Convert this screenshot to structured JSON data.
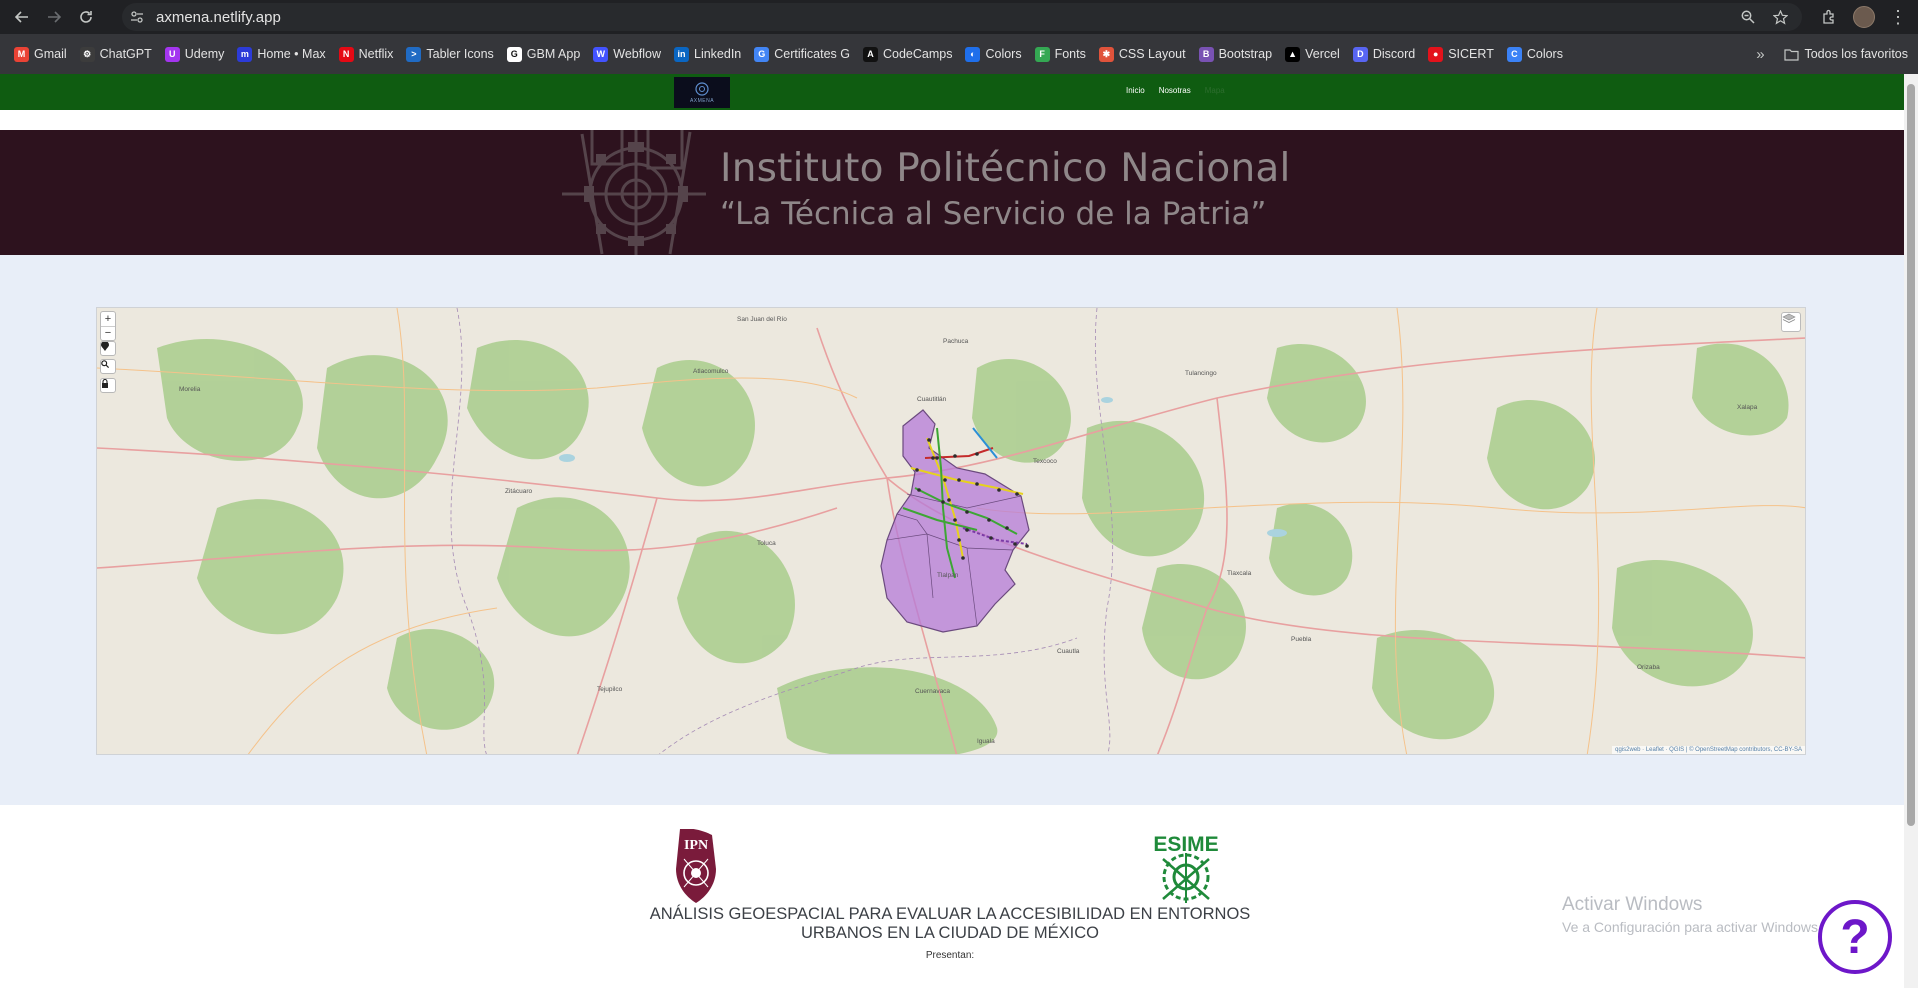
{
  "browser": {
    "url": "axmena.netlify.app",
    "bookmarks": [
      {
        "label": "Gmail",
        "icon": "gmail-icon",
        "color": "#ea4335",
        "glyph": "M"
      },
      {
        "label": "ChatGPT",
        "icon": "chatgpt-icon",
        "color": "#3c3c3c",
        "glyph": "⚙"
      },
      {
        "label": "Udemy",
        "icon": "udemy-icon",
        "color": "#a435f0",
        "glyph": "U"
      },
      {
        "label": "Home • Max",
        "icon": "max-icon",
        "color": "#2c3bd8",
        "glyph": "m"
      },
      {
        "label": "Netflix",
        "icon": "netflix-icon",
        "color": "#e50914",
        "glyph": "N"
      },
      {
        "label": "Tabler Icons",
        "icon": "tabler-icon",
        "color": "#206bc4",
        "glyph": ">"
      },
      {
        "label": "GBM App",
        "icon": "gbm-icon",
        "color": "#ffffff",
        "glyph": "G"
      },
      {
        "label": "Webflow",
        "icon": "webflow-icon",
        "color": "#4353ff",
        "glyph": "W"
      },
      {
        "label": "LinkedIn",
        "icon": "linkedin-icon",
        "color": "#0a66c2",
        "glyph": "in"
      },
      {
        "label": "Certificates G",
        "icon": "google-icon",
        "color": "#4285f4",
        "glyph": "G"
      },
      {
        "label": "CodeCamps",
        "icon": "codecamps-icon",
        "color": "#111111",
        "glyph": "A"
      },
      {
        "label": "Colors",
        "icon": "colors-icon",
        "color": "#1f6feb",
        "glyph": "◐"
      },
      {
        "label": "Fonts",
        "icon": "fonts-icon",
        "color": "#34a853",
        "glyph": "F"
      },
      {
        "label": "CSS Layout",
        "icon": "css-layout-icon",
        "color": "#e0533b",
        "glyph": "✱"
      },
      {
        "label": "Bootstrap",
        "icon": "bootstrap-icon",
        "color": "#7952b3",
        "glyph": "B"
      },
      {
        "label": "Vercel",
        "icon": "vercel-icon",
        "color": "#000000",
        "glyph": "▲"
      },
      {
        "label": "Discord",
        "icon": "discord-icon",
        "color": "#5865f2",
        "glyph": "D"
      },
      {
        "label": "SICERT",
        "icon": "sicert-icon",
        "color": "#e3121b",
        "glyph": "●"
      },
      {
        "label": "Colors",
        "icon": "colors-c-icon",
        "color": "#3b82f6",
        "glyph": "C"
      }
    ],
    "other_bookmarks": "Todos los favoritos"
  },
  "site": {
    "nav_links": [
      "Inicio",
      "Nosotras",
      "Mapa"
    ],
    "logo_text": "AXMENA",
    "hero_title": "Instituto Politécnico Nacional",
    "hero_motto": "“La Técnica al Servicio de la Patria”",
    "map_attribution": "qgis2web · Leaflet · QGIS | © OpenStreetMap contributors, CC-BY-SA",
    "map_places": [
      "Morelia",
      "Zitácuaro",
      "Toluca",
      "Cuautitlán",
      "Pachuca",
      "Texcoco",
      "Tlalpan",
      "Cuernavaca",
      "Puebla",
      "Tulancingo",
      "Xalapa",
      "Orizaba",
      "Atlacomulco",
      "San Juan del Río",
      "Tlaxcala",
      "Cuautla",
      "Iguala",
      "Tejupilco"
    ],
    "esime_label": "ESIME",
    "project_title": "ANÁLISIS GEOESPACIAL PARA EVALUAR LA ACCESIBILIDAD EN ENTORNOS URBANOS EN LA CIUDAD DE MÉXICO",
    "presentan": "Presentan:"
  },
  "os": {
    "activation_title": "Activar Windows",
    "activation_subtitle": "Ve a Configuración para activar Windows."
  },
  "colors": {
    "nav_green": "#0f5c11",
    "hero_maroon": "#2d121e",
    "map_bg": "#e8eef8",
    "cdmx_fill": "#b57bd8",
    "help_purple": "#6d17c9"
  }
}
